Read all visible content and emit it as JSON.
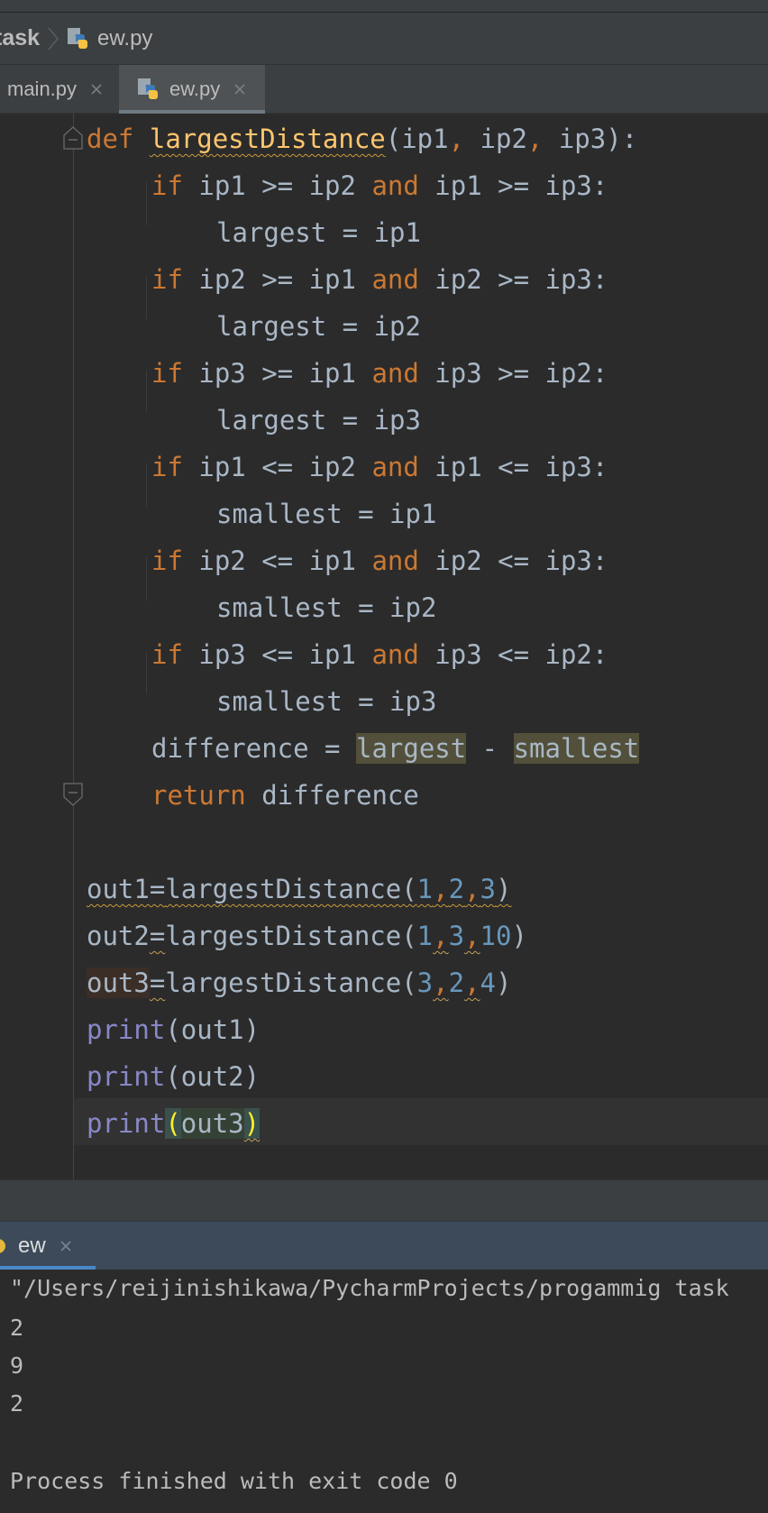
{
  "breadcrumb": {
    "root": "task",
    "file": "ew.py"
  },
  "tabs": [
    {
      "label": "main.py",
      "active": false
    },
    {
      "label": "ew.py",
      "active": true
    }
  ],
  "code": {
    "def": "def",
    "fname": "largestDistance",
    "params_a": "(ip1",
    "comma": ",",
    "params_b": " ip2",
    "params_c": " ip3):",
    "if": "if",
    "and": "and",
    "ret": "return",
    "l2": {
      "a": " ip1 >= ip2 ",
      "b": " ip1 >= ip3:"
    },
    "l3": "largest = ip1",
    "l4": {
      "a": " ip2 >= ip1 ",
      "b": " ip2 >= ip3:"
    },
    "l5": "largest = ip2",
    "l6": {
      "a": " ip3 >= ip1 ",
      "b": " ip3 >= ip2:"
    },
    "l7": "largest = ip3",
    "l8": {
      "a": " ip1 <= ip2 ",
      "b": " ip1 <= ip3:"
    },
    "l9": "smallest = ip1",
    "l10": {
      "a": " ip2 <= ip1 ",
      "b": " ip2 <= ip3:"
    },
    "l11": "smallest = ip2",
    "l12": {
      "a": " ip3 <= ip1 ",
      "b": " ip3 <= ip2:"
    },
    "l13": "smallest = ip3",
    "l14": {
      "a": "difference = ",
      "b": "largest",
      "c": " - ",
      "d": "smallest"
    },
    "l15": " difference",
    "out1": {
      "var": "out1=",
      "fn": "largestDistance(",
      "a": "1",
      "b": "2",
      "c": "3",
      "close": ")"
    },
    "out2": {
      "var": "out2",
      "eq": "=",
      "fn": "largestDistance(",
      "a": "1",
      "b": "3",
      "c": "10",
      "close": ")"
    },
    "out3": {
      "var": "out3",
      "eq": "=",
      "fn": "largestDistance(",
      "a": "3",
      "b": "2",
      "c": "4",
      "close": ")"
    },
    "print": "print",
    "p1": "(out1)",
    "p2": "(out2)",
    "p3": {
      "open": "(",
      "arg": "out3",
      "close": ")"
    }
  },
  "run": {
    "tab_label": "ew",
    "lines": [
      "\"/Users/reijinishikawa/PycharmProjects/progammig task",
      "2",
      "9",
      "2",
      "",
      "Process finished with exit code 0"
    ]
  },
  "colors": {
    "keyword": "#cc7832",
    "function": "#ffc66d",
    "number": "#6897bb",
    "builtin": "#8888c6",
    "text": "#a9b7c6"
  }
}
